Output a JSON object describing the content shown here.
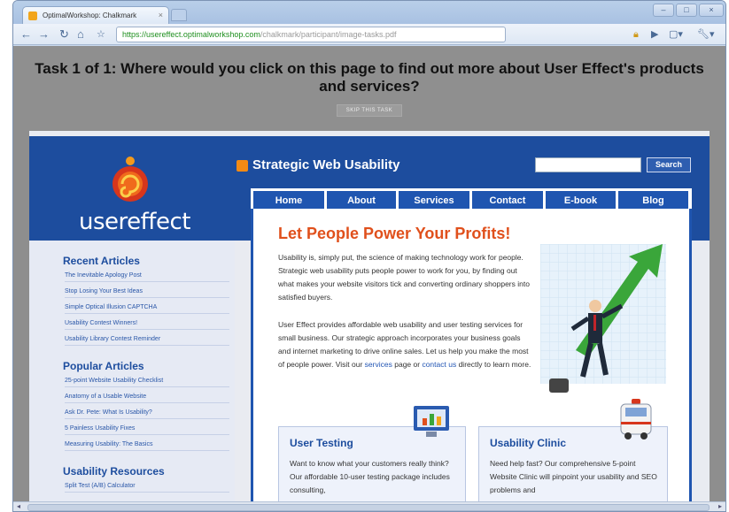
{
  "browser": {
    "tab_title": "OptimalWorkshop: Chalkmark",
    "tab_close": "×",
    "address_host": "https://usereffect.optimalworkshop.com",
    "address_path": "/chalkmark/participant/image-tasks.pdf"
  },
  "task": {
    "question": "Task 1 of 1: Where would you click on this page to find out more about User Effect's products and services?",
    "skip_label": "SKIP THIS TASK"
  },
  "site": {
    "logo_text": "usereffect",
    "tagline": "Strategic Web Usability",
    "search_button": "Search",
    "nav": [
      "Home",
      "About",
      "Services",
      "Contact",
      "E-book",
      "Blog"
    ],
    "sidebar": {
      "recent_heading": "Recent Articles",
      "recent": [
        "The Inevitable Apology Post",
        "Stop Losing Your Best Ideas",
        "Simple Optical Illusion CAPTCHA",
        "Usability Contest Winners!",
        "Usability Library Contest Reminder"
      ],
      "popular_heading": "Popular Articles",
      "popular": [
        "25-point Website Usability Checklist",
        "Anatomy of a Usable Website",
        "Ask Dr. Pete: What Is Usability?",
        "5 Painless Usability Fixes",
        "Measuring Usability: The Basics"
      ],
      "resources_heading": "Usability Resources",
      "resources": [
        "Split Test (A/B) Calculator"
      ]
    },
    "main": {
      "heading": "Let People Power Your Profits!",
      "para1": "Usability is, simply put, the science of making technology work for people. Strategic web usability puts people power to work for you, by finding out what makes your website visitors tick and converting ordinary shoppers into satisfied buyers.",
      "para2_a": "User Effect provides affordable web usability and user testing services for small business. Our strategic approach incorporates your business goals and internet marketing to drive online sales. Let us help you make the most of people power. Visit our",
      "para2_link1": "services",
      "para2_b": "page or",
      "para2_link2": "contact us",
      "para2_c": "directly to learn more.",
      "box1_heading": "User Testing",
      "box1_text": "Want to know what your customers really think? Our affordable 10-user testing package includes consulting,",
      "box2_heading": "Usability Clinic",
      "box2_text": "Need help fast? Our comprehensive 5-point Website Clinic will pinpoint your usability and SEO problems and"
    }
  },
  "colors": {
    "brand_blue": "#1d4d9e",
    "accent_orange": "#e0501c",
    "task_gray": "#8f8f8f"
  }
}
